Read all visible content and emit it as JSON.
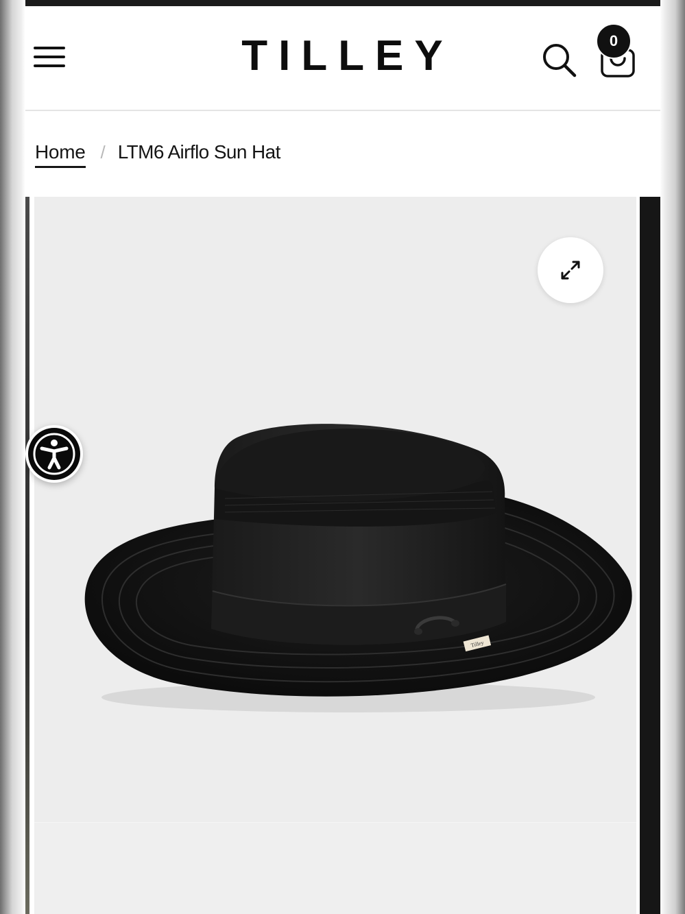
{
  "header": {
    "brand": "TILLEY",
    "menu_icon": "hamburger-menu-icon",
    "search_icon": "search-icon",
    "cart_icon": "shopping-bag-icon",
    "cart_count": "0"
  },
  "breadcrumb": {
    "home_label": "Home",
    "separator": "/",
    "current_label": "LTM6 Airflo Sun Hat"
  },
  "gallery": {
    "expand_icon": "expand-arrows-icon",
    "image_subject": "black wide-brim sun hat",
    "hat_tag_text": "Tilley"
  },
  "accessibility": {
    "icon": "accessibility-person-icon"
  },
  "colors": {
    "text": "#151515",
    "background": "#ffffff",
    "image_bg": "#ededed",
    "badge": "#111111"
  }
}
